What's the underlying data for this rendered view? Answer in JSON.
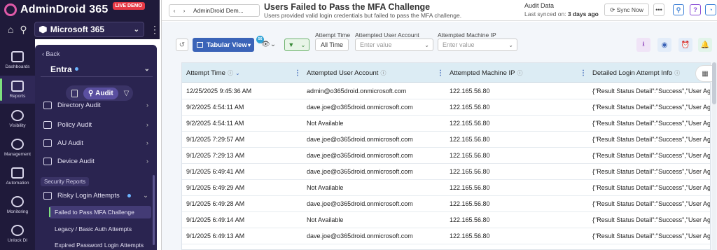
{
  "brand": {
    "name": "AdminDroid 365",
    "live_demo": "LIVE DEMO"
  },
  "tenant": "Microsoft 365",
  "rail": [
    {
      "label": "Dashboards",
      "icon": "chart-icon"
    },
    {
      "label": "Reports",
      "icon": "report-icon",
      "active": true
    },
    {
      "label": "Visibility",
      "icon": "visibility-360-icon"
    },
    {
      "label": "Management",
      "icon": "gear-icon"
    },
    {
      "label": "Automation",
      "icon": "automation-icon"
    },
    {
      "label": "Monitoring",
      "icon": "monitoring-icon"
    },
    {
      "label": "Unlock DI",
      "icon": "unlock-icon"
    }
  ],
  "nav": {
    "back": "‹ Back",
    "workload": "Entra",
    "audit_label": "Audit",
    "items": [
      "Directory Audit",
      "Policy Audit",
      "AU Audit",
      "Device Audit"
    ],
    "section": "Security Reports",
    "group": "Risky Login Attempts",
    "sub_items": [
      "Failed to Pass MFA Challenge",
      "Legacy / Basic Auth Attempts",
      "Expired Password Login Attempts"
    ]
  },
  "header": {
    "breadcrumb": "AdminDroid Dem...",
    "title": "Users Failed to Pass the MFA Challenge",
    "subtitle": "Users provided valid login credentials but failed to pass the MFA challenge.",
    "audit_data": "Audit Data",
    "synced_prefix": "Last synced on: ",
    "synced_value": "3 days ago",
    "sync_now": "Sync Now",
    "more": "•••"
  },
  "toolbar": {
    "view": "Tabular View",
    "view_badge": "56",
    "attempt_time_label": "Attempt Time",
    "attempt_time_value": "All Time",
    "account_label": "Attempted User Account",
    "account_placeholder": "Enter value",
    "ip_label": "Attempted Machine IP",
    "ip_placeholder": "Enter value"
  },
  "table": {
    "columns": [
      "Attempt Time",
      "Attempted User Account",
      "Attempted Machine IP",
      "Detailed Login Attempt Info"
    ],
    "rows": [
      [
        "12/25/2025 9:45:36 AM",
        "admin@o365droid.onmicrosoft.com",
        "122.165.56.80",
        "{\"Result Status Detail\":\"Success\",\"User Age"
      ],
      [
        "9/2/2025 4:54:11 AM",
        "dave.joe@o365droid.onmicrosoft.com",
        "122.165.56.80",
        "{\"Result Status Detail\":\"Success\",\"User Age"
      ],
      [
        "9/2/2025 4:54:11 AM",
        "Not Available",
        "122.165.56.80",
        "{\"Result Status Detail\":\"Success\",\"User Age"
      ],
      [
        "9/1/2025 7:29:57 AM",
        "dave.joe@o365droid.onmicrosoft.com",
        "122.165.56.80",
        "{\"Result Status Detail\":\"Success\",\"User Age"
      ],
      [
        "9/1/2025 7:29:13 AM",
        "dave.joe@o365droid.onmicrosoft.com",
        "122.165.56.80",
        "{\"Result Status Detail\":\"Success\",\"User Age"
      ],
      [
        "9/1/2025 6:49:41 AM",
        "dave.joe@o365droid.onmicrosoft.com",
        "122.165.56.80",
        "{\"Result Status Detail\":\"Success\",\"User Age"
      ],
      [
        "9/1/2025 6:49:29 AM",
        "Not Available",
        "122.165.56.80",
        "{\"Result Status Detail\":\"Success\",\"User Age"
      ],
      [
        "9/1/2025 6:49:28 AM",
        "dave.joe@o365droid.onmicrosoft.com",
        "122.165.56.80",
        "{\"Result Status Detail\":\"Success\",\"User Age"
      ],
      [
        "9/1/2025 6:49:14 AM",
        "Not Available",
        "122.165.56.80",
        "{\"Result Status Detail\":\"Success\",\"User Age"
      ],
      [
        "9/1/2025 6:49:13 AM",
        "dave.joe@o365droid.onmicrosoft.com",
        "122.165.56.80",
        "{\"Result Status Detail\":\"Success\",\"User Age"
      ]
    ]
  },
  "colors": {
    "accent": "#3b64b8",
    "sidebar": "#1f1a3a",
    "header_row": "#dcecf4",
    "live_demo": "#e63946"
  }
}
